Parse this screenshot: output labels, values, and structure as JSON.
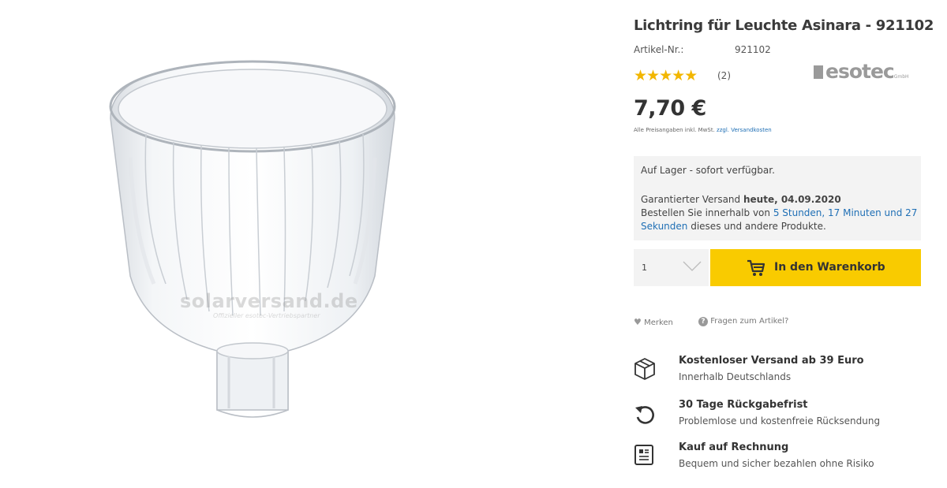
{
  "product": {
    "title": "Lichtring für Leuchte Asinara - 921102",
    "article_label": "Artikel-Nr.:",
    "article_number": "921102",
    "rating_stars": 5,
    "rating_count": "(2)",
    "price": "7,70 €",
    "price_note_prefix": "Alle Preisangaben inkl. MwSt.",
    "price_note_link": "zzgl. Versandkosten",
    "star_color": "#f2b600"
  },
  "brand": {
    "name": "esotec",
    "suffix": "GmbH"
  },
  "watermark": {
    "main": "solarversand.de",
    "sub": "Offizieller esotec-Vertriebspartner"
  },
  "stock": {
    "status": "Auf Lager - sofort verfügbar.",
    "ship_prefix": "Garantierter Versand ",
    "ship_date": "heute, 04.09.2020",
    "order_prefix": "Bestellen Sie innerhalb von ",
    "order_time_1": "5 Stunden, 17 Minuten und 27",
    "order_time_2": "Sekunden",
    "order_suffix": " dieses und andere Produkte."
  },
  "cart": {
    "quantity": "1",
    "button_label": "In den Warenkorb",
    "button_color": "#f9cb00"
  },
  "actions": {
    "merken": "Merken",
    "fragen": "Fragen zum Artikel?"
  },
  "benefits": [
    {
      "icon": "package-icon",
      "title": "Kostenloser Versand ab 39 Euro",
      "desc": "Innerhalb Deutschlands"
    },
    {
      "icon": "return-arrow-icon",
      "title": "30 Tage Rückgabefrist",
      "desc": "Problemlose und kostenfreie Rücksendung"
    },
    {
      "icon": "invoice-icon",
      "title": "Kauf auf Rechnung",
      "desc": "Bequem und sicher bezahlen ohne Risiko"
    }
  ]
}
